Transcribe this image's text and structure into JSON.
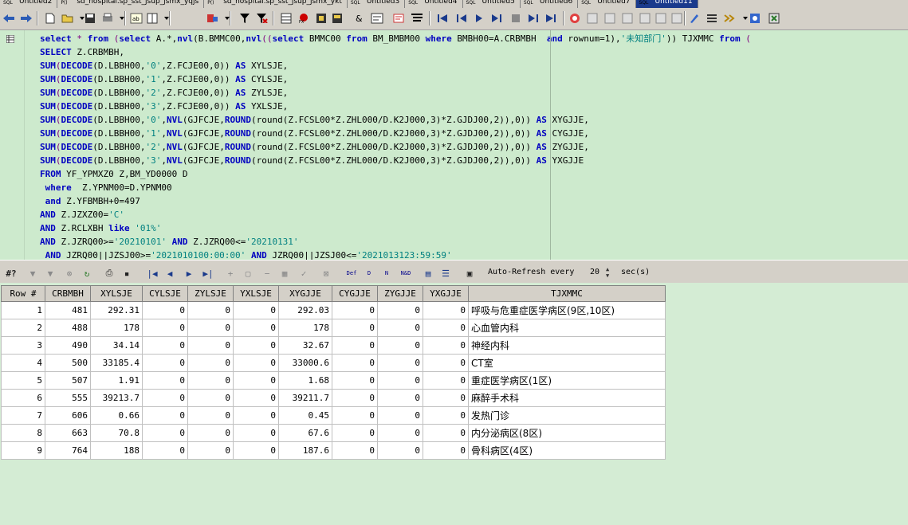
{
  "tabs": [
    {
      "label": "Untitled2",
      "type": "sql"
    },
    {
      "label": "sd_hospital.sp_sst_jsup_jsmx_yqjs",
      "type": "proc"
    },
    {
      "label": "sd_hospital.sp_sst_jsup_jsmx_ykt",
      "type": "proc"
    },
    {
      "label": "Untitled3",
      "type": "sql"
    },
    {
      "label": "Untitled4",
      "type": "sql"
    },
    {
      "label": "Untitled5",
      "type": "sql"
    },
    {
      "label": "Untitled6",
      "type": "sql"
    },
    {
      "label": "Untitled7",
      "type": "sql"
    },
    {
      "label": "Untitled11",
      "type": "sql",
      "active": true
    }
  ],
  "tab_marks": {
    "sql": "SQL",
    "proc": "P()"
  },
  "editor": {
    "lines": [
      [
        {
          "t": "select",
          "c": "kw"
        },
        {
          "t": " * ",
          "c": "op"
        },
        {
          "t": "from",
          "c": "kw"
        },
        {
          "t": " (",
          "c": "op"
        },
        {
          "t": "select",
          "c": "kw"
        },
        {
          "t": " A.*,",
          "c": ""
        },
        {
          "t": "nvl",
          "c": "fn"
        },
        {
          "t": "(B.BMMC00,",
          "c": ""
        },
        {
          "t": "nvl",
          "c": "fn"
        },
        {
          "t": "((",
          "c": "op"
        },
        {
          "t": "select",
          "c": "kw"
        },
        {
          "t": " BMMC00 ",
          "c": ""
        },
        {
          "t": "from",
          "c": "kw"
        },
        {
          "t": " BM_BMBM00 ",
          "c": ""
        },
        {
          "t": "where",
          "c": "kw"
        },
        {
          "t": " BMBH00=A.CRBMBH  ",
          "c": ""
        },
        {
          "t": "and",
          "c": "kw"
        },
        {
          "t": " rownum=1),",
          "c": ""
        },
        {
          "t": "'未知部门'",
          "c": "str"
        },
        {
          "t": ")) TJXMMC ",
          "c": ""
        },
        {
          "t": "from",
          "c": "kw"
        },
        {
          "t": " (",
          "c": "op"
        }
      ],
      [
        {
          "t": "SELECT",
          "c": "kw"
        },
        {
          "t": " Z.CRBMBH,",
          "c": ""
        }
      ],
      [
        {
          "t": "SUM",
          "c": "fn"
        },
        {
          "t": "(",
          "c": "op"
        },
        {
          "t": "DECODE",
          "c": "fn"
        },
        {
          "t": "(D.LBBH00,",
          "c": ""
        },
        {
          "t": "'0'",
          "c": "str"
        },
        {
          "t": ",Z.FCJE00,0)) ",
          "c": ""
        },
        {
          "t": "AS",
          "c": "kw"
        },
        {
          "t": " XYLSJE,",
          "c": ""
        }
      ],
      [
        {
          "t": "SUM",
          "c": "fn"
        },
        {
          "t": "(",
          "c": "op"
        },
        {
          "t": "DECODE",
          "c": "fn"
        },
        {
          "t": "(D.LBBH00,",
          "c": ""
        },
        {
          "t": "'1'",
          "c": "str"
        },
        {
          "t": ",Z.FCJE00,0)) ",
          "c": ""
        },
        {
          "t": "AS",
          "c": "kw"
        },
        {
          "t": " CYLSJE,",
          "c": ""
        }
      ],
      [
        {
          "t": "SUM",
          "c": "fn"
        },
        {
          "t": "(",
          "c": "op"
        },
        {
          "t": "DECODE",
          "c": "fn"
        },
        {
          "t": "(D.LBBH00,",
          "c": ""
        },
        {
          "t": "'2'",
          "c": "str"
        },
        {
          "t": ",Z.FCJE00,0)) ",
          "c": ""
        },
        {
          "t": "AS",
          "c": "kw"
        },
        {
          "t": " ZYLSJE,",
          "c": ""
        }
      ],
      [
        {
          "t": "SUM",
          "c": "fn"
        },
        {
          "t": "(",
          "c": "op"
        },
        {
          "t": "DECODE",
          "c": "fn"
        },
        {
          "t": "(D.LBBH00,",
          "c": ""
        },
        {
          "t": "'3'",
          "c": "str"
        },
        {
          "t": ",Z.FCJE00,0)) ",
          "c": ""
        },
        {
          "t": "AS",
          "c": "kw"
        },
        {
          "t": " YXLSJE,",
          "c": ""
        }
      ],
      [
        {
          "t": "SUM",
          "c": "fn"
        },
        {
          "t": "(",
          "c": "op"
        },
        {
          "t": "DECODE",
          "c": "fn"
        },
        {
          "t": "(D.LBBH00,",
          "c": ""
        },
        {
          "t": "'0'",
          "c": "str"
        },
        {
          "t": ",",
          "c": ""
        },
        {
          "t": "NVL",
          "c": "fn"
        },
        {
          "t": "(GJFCJE,",
          "c": ""
        },
        {
          "t": "ROUND",
          "c": "fn"
        },
        {
          "t": "(round(Z.FCSL00*Z.ZHL000/D.K2J000,3)*Z.GJDJ00,2)),0)) ",
          "c": ""
        },
        {
          "t": "AS",
          "c": "kw"
        },
        {
          "t": " XYGJJE,",
          "c": ""
        }
      ],
      [
        {
          "t": "SUM",
          "c": "fn"
        },
        {
          "t": "(",
          "c": "op"
        },
        {
          "t": "DECODE",
          "c": "fn"
        },
        {
          "t": "(D.LBBH00,",
          "c": ""
        },
        {
          "t": "'1'",
          "c": "str"
        },
        {
          "t": ",",
          "c": ""
        },
        {
          "t": "NVL",
          "c": "fn"
        },
        {
          "t": "(GJFCJE,",
          "c": ""
        },
        {
          "t": "ROUND",
          "c": "fn"
        },
        {
          "t": "(round(Z.FCSL00*Z.ZHL000/D.K2J000,3)*Z.GJDJ00,2)),0)) ",
          "c": ""
        },
        {
          "t": "AS",
          "c": "kw"
        },
        {
          "t": " CYGJJE,",
          "c": ""
        }
      ],
      [
        {
          "t": "SUM",
          "c": "fn"
        },
        {
          "t": "(",
          "c": "op"
        },
        {
          "t": "DECODE",
          "c": "fn"
        },
        {
          "t": "(D.LBBH00,",
          "c": ""
        },
        {
          "t": "'2'",
          "c": "str"
        },
        {
          "t": ",",
          "c": ""
        },
        {
          "t": "NVL",
          "c": "fn"
        },
        {
          "t": "(GJFCJE,",
          "c": ""
        },
        {
          "t": "ROUND",
          "c": "fn"
        },
        {
          "t": "(round(Z.FCSL00*Z.ZHL000/D.K2J000,3)*Z.GJDJ00,2)),0)) ",
          "c": ""
        },
        {
          "t": "AS",
          "c": "kw"
        },
        {
          "t": " ZYGJJE,",
          "c": ""
        }
      ],
      [
        {
          "t": "SUM",
          "c": "fn"
        },
        {
          "t": "(",
          "c": "op"
        },
        {
          "t": "DECODE",
          "c": "fn"
        },
        {
          "t": "(D.LBBH00,",
          "c": ""
        },
        {
          "t": "'3'",
          "c": "str"
        },
        {
          "t": ",",
          "c": ""
        },
        {
          "t": "NVL",
          "c": "fn"
        },
        {
          "t": "(GJFCJE,",
          "c": ""
        },
        {
          "t": "ROUND",
          "c": "fn"
        },
        {
          "t": "(round(Z.FCSL00*Z.ZHL000/D.K2J000,3)*Z.GJDJ00,2)),0)) ",
          "c": ""
        },
        {
          "t": "AS",
          "c": "kw"
        },
        {
          "t": " YXGJJE",
          "c": ""
        }
      ],
      [
        {
          "t": "FROM",
          "c": "kw"
        },
        {
          "t": " YF_YPMXZ0 Z,BM_YD0000 D",
          "c": ""
        }
      ],
      [
        {
          "t": " where",
          "c": "kw"
        },
        {
          "t": "  Z.YPNM00=D.YPNM00",
          "c": ""
        }
      ],
      [
        {
          "t": " and",
          "c": "kw"
        },
        {
          "t": " Z.YFBMBH+0=497",
          "c": ""
        }
      ],
      [
        {
          "t": "AND",
          "c": "kw"
        },
        {
          "t": " Z.JZXZ00=",
          "c": ""
        },
        {
          "t": "'C'",
          "c": "str"
        }
      ],
      [
        {
          "t": "AND",
          "c": "kw"
        },
        {
          "t": " Z.RCLXBH ",
          "c": ""
        },
        {
          "t": "like",
          "c": "kw"
        },
        {
          "t": " ",
          "c": ""
        },
        {
          "t": "'01%'",
          "c": "str"
        }
      ],
      [
        {
          "t": "AND",
          "c": "kw"
        },
        {
          "t": " Z.JZRQ00>=",
          "c": ""
        },
        {
          "t": "'20210101'",
          "c": "str"
        },
        {
          "t": " ",
          "c": ""
        },
        {
          "t": "AND",
          "c": "kw"
        },
        {
          "t": " Z.JZRQ00<=",
          "c": ""
        },
        {
          "t": "'20210131'",
          "c": "str"
        }
      ],
      [
        {
          "t": " AND",
          "c": "kw"
        },
        {
          "t": " JZRQ00||JZSJ00>=",
          "c": ""
        },
        {
          "t": "'2021010100:00:00'",
          "c": "str"
        },
        {
          "t": " ",
          "c": ""
        },
        {
          "t": "AND",
          "c": "kw"
        },
        {
          "t": " JZRQ00||JZSJ00<=",
          "c": ""
        },
        {
          "t": "'2021013123:59:59'",
          "c": "str"
        }
      ]
    ]
  },
  "grid_toolbar": {
    "auto_refresh_label": "Auto-Refresh every",
    "interval": "20",
    "unit": "sec(s)",
    "def_label": "Def",
    "d_label": "D",
    "n_label": "N",
    "nd_label": "N&D",
    "hash_label": "#?"
  },
  "grid": {
    "columns": [
      "Row #",
      "CRBMBH",
      "XYLSJE",
      "CYLSJE",
      "ZYLSJE",
      "YXLSJE",
      "XYGJJE",
      "CYGJJE",
      "ZYGJJE",
      "YXGJJE",
      "TJXMMC"
    ],
    "rows": [
      [
        "1",
        "481",
        "292.31",
        "0",
        "0",
        "0",
        "292.03",
        "0",
        "0",
        "0",
        "呼吸与危重症医学病区(9区,10区)"
      ],
      [
        "2",
        "488",
        "178",
        "0",
        "0",
        "0",
        "178",
        "0",
        "0",
        "0",
        "心血管内科"
      ],
      [
        "3",
        "490",
        "34.14",
        "0",
        "0",
        "0",
        "32.67",
        "0",
        "0",
        "0",
        "神经内科"
      ],
      [
        "4",
        "500",
        "33185.4",
        "0",
        "0",
        "0",
        "33000.6",
        "0",
        "0",
        "0",
        "CT室"
      ],
      [
        "5",
        "507",
        "1.91",
        "0",
        "0",
        "0",
        "1.68",
        "0",
        "0",
        "0",
        "重症医学病区(1区)"
      ],
      [
        "6",
        "555",
        "39213.7",
        "0",
        "0",
        "0",
        "39211.7",
        "0",
        "0",
        "0",
        "麻醉手术科"
      ],
      [
        "7",
        "606",
        "0.66",
        "0",
        "0",
        "0",
        "0.45",
        "0",
        "0",
        "0",
        "发热门诊"
      ],
      [
        "8",
        "663",
        "70.8",
        "0",
        "0",
        "0",
        "67.6",
        "0",
        "0",
        "0",
        "内分泌病区(8区)"
      ],
      [
        "9",
        "764",
        "188",
        "0",
        "0",
        "0",
        "187.6",
        "0",
        "0",
        "0",
        "骨科病区(4区)"
      ]
    ]
  },
  "colors": {
    "editor_bg": "#cdeacd",
    "keyword": "#0000c0",
    "string": "#008080",
    "active_tab": "#1a3a8c"
  }
}
